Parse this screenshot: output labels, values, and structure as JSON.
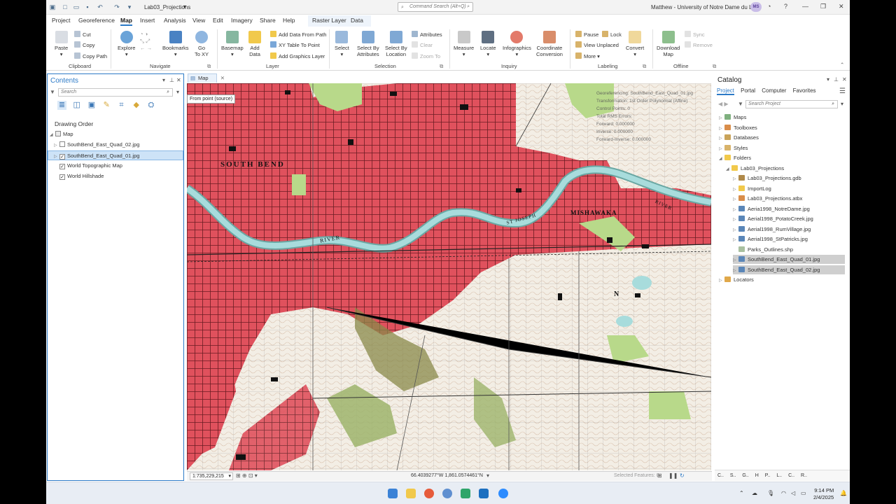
{
  "titlebar": {
    "project_name": "Lab03_Projections",
    "command_search_placeholder": "Command Search (Alt+Q)",
    "user": "Matthew - University of Notre Dame du Lac",
    "user_initials": "MS"
  },
  "menu": {
    "tabs": [
      "Project",
      "Georeference",
      "Map",
      "Insert",
      "Analysis",
      "View",
      "Edit",
      "Imagery",
      "Share",
      "Help"
    ],
    "active_tab": "Map",
    "context_tabs": [
      "Raster Layer",
      "Data"
    ]
  },
  "ribbon": {
    "clipboard": {
      "paste": "Paste",
      "cut": "Cut",
      "copy": "Copy",
      "copy_path": "Copy Path",
      "label": "Clipboard"
    },
    "navigate": {
      "explore": "Explore",
      "bookmarks": "Bookmarks",
      "goto_xy": "Go\nTo XY",
      "label": "Navigate"
    },
    "layer": {
      "basemap": "Basemap",
      "add_data": "Add\nData",
      "add_data_from_path": "Add Data From Path",
      "xy_table": "XY Table To Point",
      "add_graphics": "Add Graphics Layer",
      "label": "Layer"
    },
    "selection": {
      "select": "Select",
      "select_by_attr": "Select By\nAttributes",
      "select_by_loc": "Select By\nLocation",
      "attributes": "Attributes",
      "clear": "Clear",
      "zoom_to": "Zoom To",
      "label": "Selection"
    },
    "inquiry": {
      "measure": "Measure",
      "locate": "Locate",
      "infographics": "Infographics",
      "coord_conv": "Coordinate\nConversion",
      "label": "Inquiry"
    },
    "labeling": {
      "pause": "Pause",
      "lock": "Lock",
      "view_unplaced": "View Unplaced",
      "more": "More",
      "convert": "Convert",
      "label": "Labeling"
    },
    "offline": {
      "download": "Download\nMap",
      "sync": "Sync",
      "remove": "Remove",
      "label": "Offline"
    }
  },
  "contents": {
    "title": "Contents",
    "search_placeholder": "Search",
    "drawing_order": "Drawing Order",
    "map_name": "Map",
    "layers": [
      {
        "name": "SouthBend_East_Quad_02.jpg",
        "checked": false,
        "selected": false
      },
      {
        "name": "SouthBend_East_Quad_01.jpg",
        "checked": true,
        "selected": true
      },
      {
        "name": "World Topographic Map",
        "checked": true,
        "selected": false
      },
      {
        "name": "World Hillshade",
        "checked": true,
        "selected": false
      }
    ]
  },
  "map": {
    "tab_label": "Map",
    "georef_tag": "From point (source)",
    "georef_info": [
      "Georeferencing: SouthBend_East_Quad_01.jpg",
      "Transformation: 1st Order Polynomial (Affine)",
      "Control Points: 0",
      "Total RMS Errors:",
      "Forward: 0.000000",
      "Inverse: 0.000000",
      "Forward-Inverse: 0.000000"
    ],
    "labels": [
      "SOUTH BEND",
      "MISHAWAKA",
      "RIVER",
      "ST JOSEPH",
      "N",
      "RIVER"
    ],
    "scale": "1:735,229,215",
    "coordinates": "66.4039277°W 1,861.0574461°N",
    "selected_features": "Selected Features: 0"
  },
  "catalog": {
    "title": "Catalog",
    "tabs": [
      "Project",
      "Portal",
      "Computer",
      "Favorites"
    ],
    "active_tab": "Project",
    "search_placeholder": "Search Project",
    "items": [
      {
        "label": "Maps",
        "indent": 0,
        "icon": "map-folder"
      },
      {
        "label": "Toolboxes",
        "indent": 0,
        "icon": "toolbox"
      },
      {
        "label": "Databases",
        "indent": 0,
        "icon": "database"
      },
      {
        "label": "Styles",
        "indent": 0,
        "icon": "style"
      },
      {
        "label": "Folders",
        "indent": 0,
        "icon": "folder"
      },
      {
        "label": "Lab03_Projections",
        "indent": 1,
        "icon": "folder"
      },
      {
        "label": "Lab03_Projections.gdb",
        "indent": 2,
        "icon": "gdb"
      },
      {
        "label": "ImportLog",
        "indent": 2,
        "icon": "folder"
      },
      {
        "label": "Lab03_Projections.atbx",
        "indent": 2,
        "icon": "toolbox"
      },
      {
        "label": "Aeria1998_NotreDame.jpg",
        "indent": 2,
        "icon": "raster"
      },
      {
        "label": "Aerial1998_PotatoCreek.jpg",
        "indent": 2,
        "icon": "raster"
      },
      {
        "label": "Aerial1998_RumVillage.jpg",
        "indent": 2,
        "icon": "raster"
      },
      {
        "label": "Aerial1998_StPatricks.jpg",
        "indent": 2,
        "icon": "raster"
      },
      {
        "label": "Parks_Outlines.shp",
        "indent": 2,
        "icon": "shapefile"
      },
      {
        "label": "SouthBend_East_Quad_01.jpg",
        "indent": 2,
        "icon": "raster",
        "selected": true
      },
      {
        "label": "SouthBend_East_Quad_02.jpg",
        "indent": 2,
        "icon": "raster",
        "selected": true
      },
      {
        "label": "Locators",
        "indent": 0,
        "icon": "locator"
      }
    ],
    "bottom_tabs": [
      "C..",
      "S..",
      "G..",
      "H",
      "P..",
      "L..",
      "C..",
      "R.."
    ]
  },
  "taskbar": {
    "time": "9:14 PM",
    "date": "2/4/2025"
  },
  "colors": {
    "accent": "#2c7ac7",
    "urban": "#e0515d",
    "water": "#9fd6d6",
    "vegetation": "#b8d98a"
  }
}
